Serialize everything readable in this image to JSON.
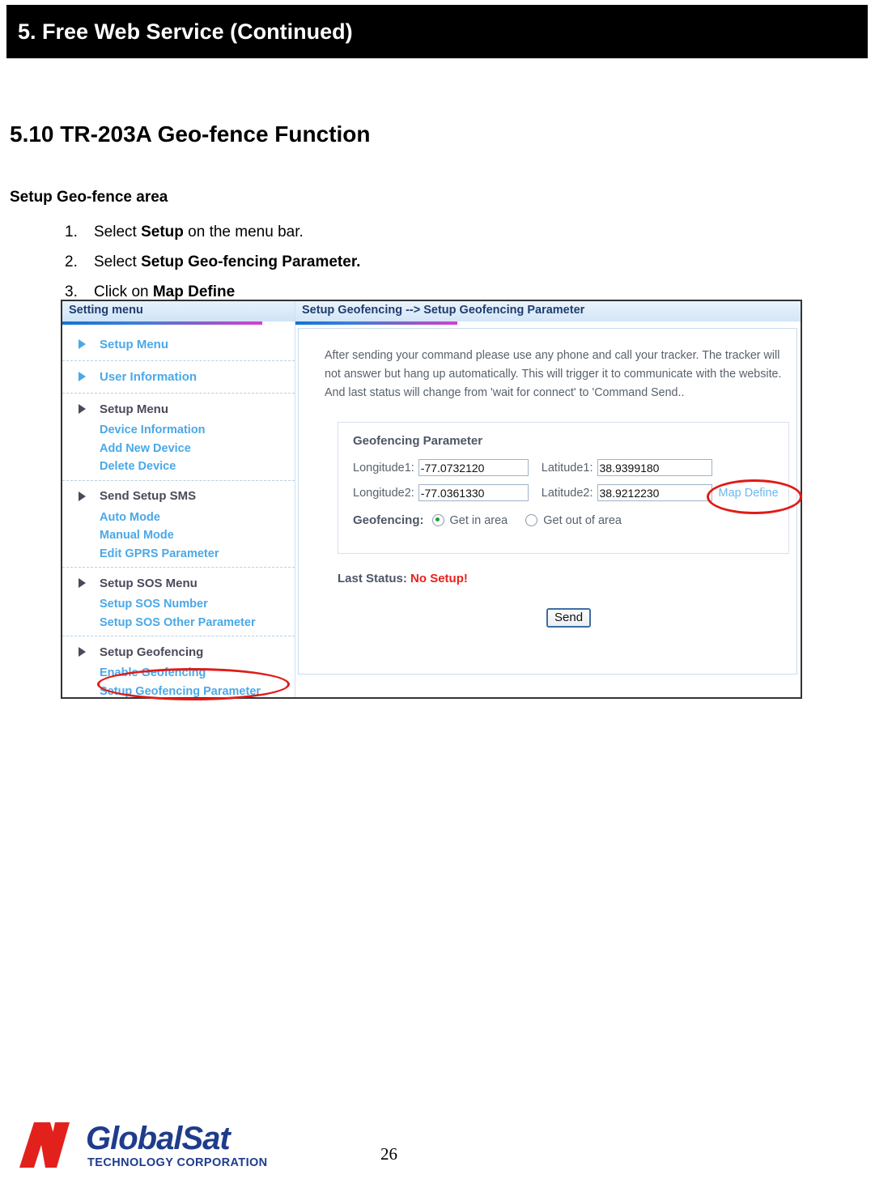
{
  "document": {
    "chapter_title": "5. Free Web Service (Continued)",
    "section_title": "5.10 TR-203A Geo-fence Function",
    "subheading": "Setup Geo-fence area",
    "steps": [
      {
        "num": "1.",
        "pre": "Select ",
        "bold": "Setup",
        "post": " on the menu bar."
      },
      {
        "num": "2.",
        "pre": "Select ",
        "bold": "Setup Geo-fencing Parameter.",
        "post": ""
      },
      {
        "num": "3.",
        "pre": "Click on ",
        "bold": "Map Define",
        "post": ""
      }
    ],
    "page_number": "26"
  },
  "screenshot": {
    "sidebar": {
      "header": "Setting menu",
      "groups": [
        {
          "parent": "Setup Menu",
          "style": "light",
          "children": []
        },
        {
          "parent": "User Information",
          "style": "light",
          "children": []
        },
        {
          "parent": "Setup Menu",
          "style": "dark",
          "children": [
            "Device Information",
            "Add New Device",
            "Delete Device"
          ]
        },
        {
          "parent": "Send Setup SMS",
          "style": "dark",
          "children": [
            "Auto Mode",
            "Manual Mode",
            "Edit GPRS Parameter"
          ]
        },
        {
          "parent": "Setup SOS Menu",
          "style": "dark",
          "children": [
            "Setup SOS Number",
            "Setup SOS Other Parameter"
          ]
        },
        {
          "parent": "Setup Geofencing",
          "style": "dark",
          "children": [
            "Enable Geofencing",
            "Setup Geofencing Parameter"
          ]
        }
      ]
    },
    "content": {
      "header": "Setup Geofencing --> Setup Geofencing Parameter",
      "intro": "After sending your command please use any phone and call your tracker. The tracker will not answer but hang up automatically. This will trigger it to communicate with the website. And last status will change from 'wait for connect' to 'Command Send..",
      "param_box": {
        "title": "Geofencing Parameter",
        "longitude1_label": "Longitude1:",
        "longitude1_value": "-77.0732120",
        "latitude1_label": "Latitude1:",
        "latitude1_value": "38.9399180",
        "longitude2_label": "Longitude2:",
        "longitude2_value": "-77.0361330",
        "latitude2_label": "Latitude2:",
        "latitude2_value": "38.9212230",
        "map_define_link": "Map Define",
        "geofencing_label": "Geofencing:",
        "option_in": "Get in area",
        "option_out": "Get out of area",
        "selected_option": "Get in area"
      },
      "last_status_label": "Last Status:",
      "last_status_value": "No Setup!",
      "send_button": "Send"
    },
    "annotations": {
      "highlight_menu_item": "Setup Geofencing Parameter",
      "highlight_link": "Map Define",
      "highlight_color": "#e01b16"
    }
  },
  "footer": {
    "brand_main": "GlobalSat",
    "brand_sub": "TECHNOLOGY CORPORATION",
    "brand_color": "#1f3c8c",
    "mark_color": "#e2211c"
  }
}
